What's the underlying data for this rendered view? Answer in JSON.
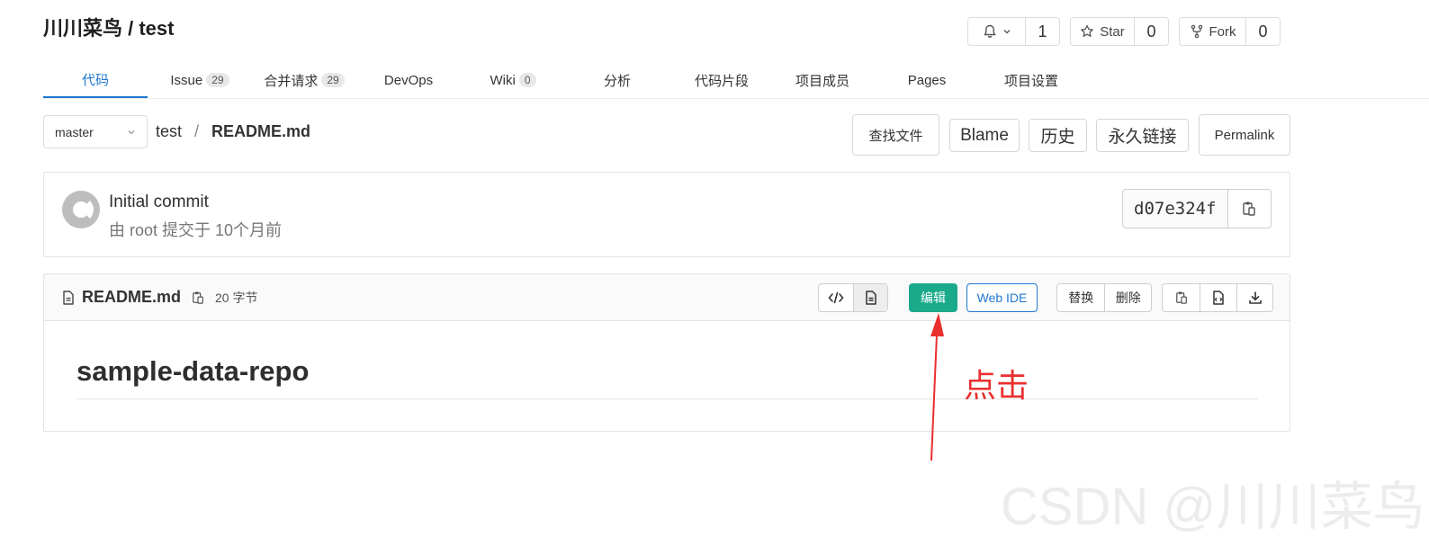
{
  "header": {
    "title": "川川菜鸟 / test",
    "watch_count": "1",
    "star_label": "Star",
    "star_count": "0",
    "fork_label": "Fork",
    "fork_count": "0"
  },
  "nav": {
    "items": [
      {
        "label": "代码",
        "badge": "",
        "active": true
      },
      {
        "label": "Issue",
        "badge": "29"
      },
      {
        "label": "合并请求",
        "badge": "29"
      },
      {
        "label": "DevOps",
        "badge": ""
      },
      {
        "label": "Wiki",
        "badge": "0"
      },
      {
        "label": "分析",
        "badge": ""
      },
      {
        "label": "代码片段",
        "badge": ""
      },
      {
        "label": "项目成员",
        "badge": ""
      },
      {
        "label": "Pages",
        "badge": ""
      },
      {
        "label": "项目设置",
        "badge": ""
      }
    ]
  },
  "path": {
    "branch": "master",
    "repo": "test",
    "separator": "/",
    "file": "README.md"
  },
  "actions": {
    "find_file": "查找文件",
    "blame": "Blame",
    "history": "历史",
    "permanent_link": "永久链接",
    "permalink": "Permalink"
  },
  "commit": {
    "title": "Initial commit",
    "meta": "由 root 提交于 10个月前",
    "sha": "d07e324f"
  },
  "file": {
    "name": "README.md",
    "size": "20 字节",
    "edit": "编辑",
    "web_ide": "Web IDE",
    "replace": "替换",
    "delete": "删除"
  },
  "readme": {
    "heading": "sample-data-repo"
  },
  "annotation": {
    "text": "点击",
    "color": "#ea2f2f"
  },
  "watermark": "CSDN @川川菜鸟",
  "colors": {
    "accent": "#1f78d1",
    "edit_button": "#1aaa8a"
  }
}
